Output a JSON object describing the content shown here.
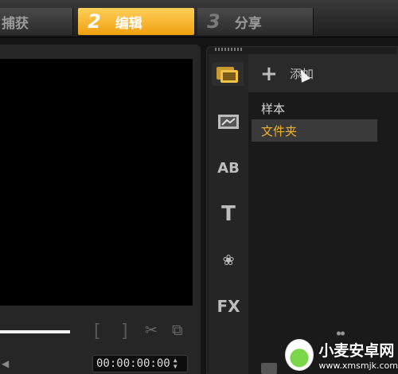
{
  "steps": {
    "capture": {
      "label": "捕获"
    },
    "edit": {
      "num": "2",
      "label": "编辑"
    },
    "share": {
      "num": "3",
      "label": "分享"
    }
  },
  "preview": {
    "timecode": "00:00:00:00",
    "bracket_in": "[",
    "bracket_out": "]",
    "cut_icon": "✂",
    "clip_icon": "⧉"
  },
  "library": {
    "add_label": "添加",
    "add_symbol": "+",
    "tabs": [
      {
        "name": "media",
        "glyph": "▤"
      },
      {
        "name": "instant-project",
        "glyph": "▦"
      },
      {
        "name": "transition",
        "glyph": "AB"
      },
      {
        "name": "title",
        "glyph": "T"
      },
      {
        "name": "graphic",
        "glyph": "❀"
      },
      {
        "name": "filter",
        "glyph": "FX"
      }
    ],
    "folders": [
      {
        "label": "样本"
      },
      {
        "label": "文件夹"
      }
    ],
    "selected_folder": "文件夹"
  },
  "watermark": {
    "title": "小麦安卓网",
    "url": "www.xmsmjk.com"
  },
  "colors": {
    "accent": "#f2b32a",
    "active_step": "#f5b52c"
  }
}
